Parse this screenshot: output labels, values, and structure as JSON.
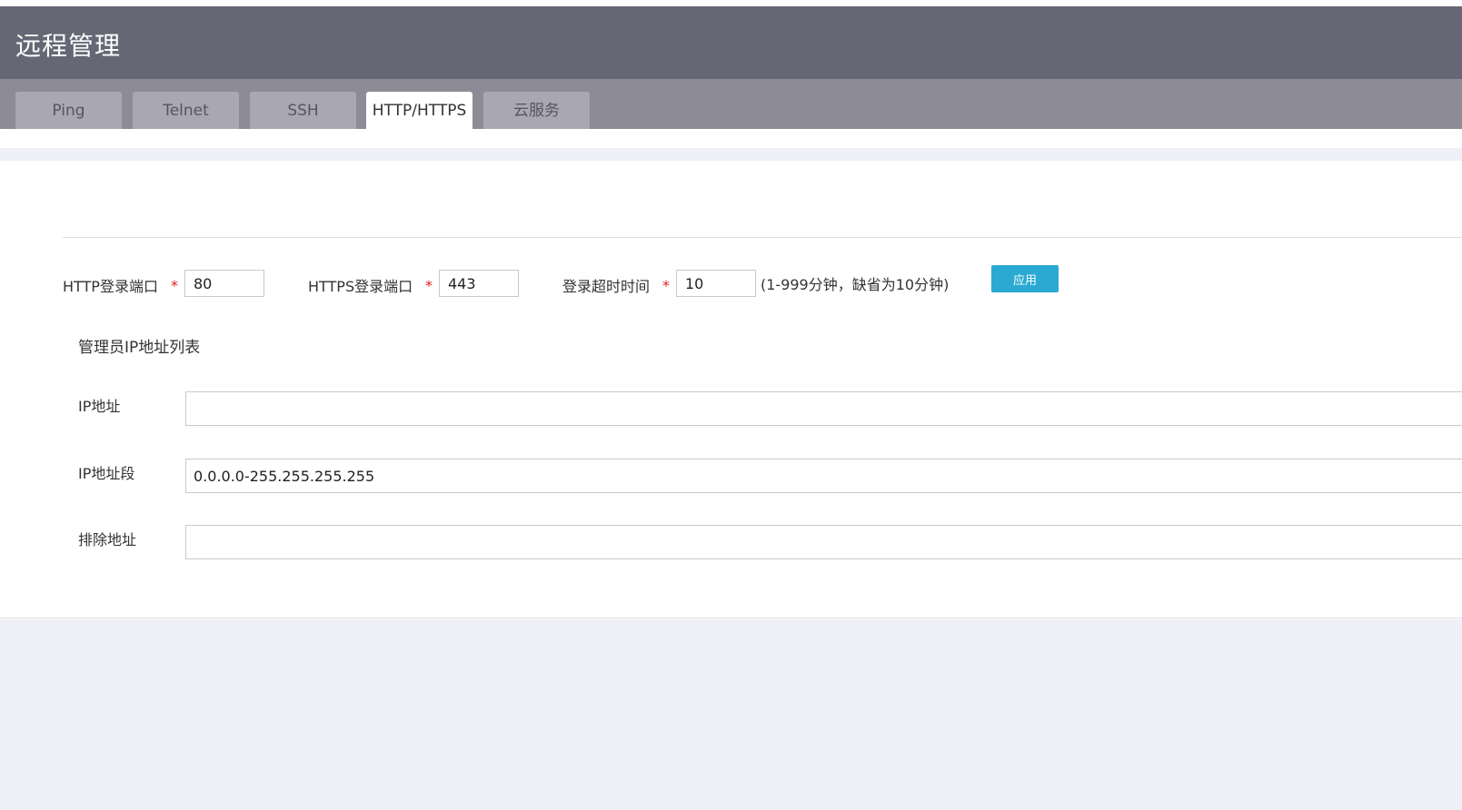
{
  "header": {
    "title": "远程管理"
  },
  "tabs": [
    {
      "label": "Ping",
      "active": false
    },
    {
      "label": "Telnet",
      "active": false
    },
    {
      "label": "SSH",
      "active": false
    },
    {
      "label": "HTTP/HTTPS",
      "active": true
    },
    {
      "label": "云服务",
      "active": false
    }
  ],
  "form": {
    "http_port": {
      "label": "HTTP登录端口",
      "required_mark": "*",
      "value": "80"
    },
    "https_port": {
      "label": "HTTPS登录端口",
      "required_mark": "*",
      "value": "443"
    },
    "timeout": {
      "label": "登录超时时间",
      "required_mark": "*",
      "value": "10",
      "hint": "(1-999分钟，缺省为10分钟)"
    },
    "apply_label": "应用"
  },
  "admin_ip": {
    "section_title": "管理员IP地址列表",
    "ip_address": {
      "label": "IP地址",
      "value": ""
    },
    "ip_range": {
      "label": "IP地址段",
      "value": "0.0.0.0-255.255.255.255"
    },
    "exclude": {
      "label": "排除地址",
      "value": ""
    }
  },
  "colors": {
    "header_bg": "#666774",
    "tabbar_bg": "#8c8b96",
    "tab_inactive_bg": "#a9a8b2",
    "accent_button": "#2aa9d2",
    "required_mark": "#e02020",
    "page_background": "#efeff6"
  }
}
